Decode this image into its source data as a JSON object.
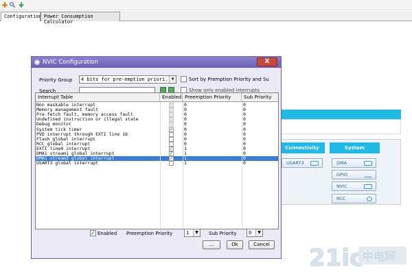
{
  "tabs": [
    "Configuration",
    "Power Consumption Calculator"
  ],
  "background": {
    "columns": [
      "Connectivity",
      "System"
    ],
    "connectivity_buttons": [
      "USART3"
    ],
    "system_buttons": [
      "DMA",
      "GPIO",
      "NVIC",
      "RCC"
    ]
  },
  "dialog": {
    "title": "NVIC Configuration",
    "close_label": "X",
    "priority_group_label": "Priority Group",
    "priority_group_value": "4 bits for pre-emption priori...",
    "sort_label": "Sort by Premption Priority and Su",
    "search_label": "Search",
    "show_available_label": "Show only enabled interrupts",
    "table": {
      "headers": [
        "Interrupt Table",
        "Enabled",
        "Preemption Priority",
        "Sub Priority"
      ],
      "rows": [
        {
          "name": "Non maskable interrupt",
          "enabled": null,
          "pre": "0",
          "sub": "0"
        },
        {
          "name": "Memory management fault",
          "enabled": null,
          "pre": "0",
          "sub": "0"
        },
        {
          "name": "Pre-fetch fault, memory access fault",
          "enabled": null,
          "pre": "0",
          "sub": "0"
        },
        {
          "name": "Undefined instruction or illegal state",
          "enabled": null,
          "pre": "0",
          "sub": "0"
        },
        {
          "name": "Debug monitor",
          "enabled": null,
          "pre": "0",
          "sub": "0"
        },
        {
          "name": "System tick timer",
          "enabled": true,
          "pre": "0",
          "sub": "0"
        },
        {
          "name": "PVD interrupt through EXTI line 16",
          "enabled": false,
          "pre": "0",
          "sub": "0"
        },
        {
          "name": "Flash global interrupt",
          "enabled": false,
          "pre": "0",
          "sub": "0"
        },
        {
          "name": "RCC global interrupt",
          "enabled": false,
          "pre": "0",
          "sub": "0"
        },
        {
          "name": "EXTI line0 interrupt",
          "enabled": true,
          "pre": "1",
          "sub": "0"
        },
        {
          "name": "DMA1 stream1 global interrupt",
          "enabled": true,
          "pre": "1",
          "sub": "0"
        },
        {
          "name": "DMA1 stream3 global interrupt",
          "enabled": true,
          "pre": "1",
          "sub": "0",
          "selected": true
        },
        {
          "name": "USART3 global interrupt",
          "enabled": false,
          "pre": "1",
          "sub": "0"
        }
      ]
    },
    "footer": {
      "enabled_label": "Enabled",
      "preemption_label": "Preemption Priority",
      "preemption_value": "1",
      "sub_label": "Sub Priority",
      "sub_value": "0",
      "buttons": [
        "...",
        "Ok",
        "Cancel"
      ]
    }
  },
  "watermark": "21ic.com"
}
